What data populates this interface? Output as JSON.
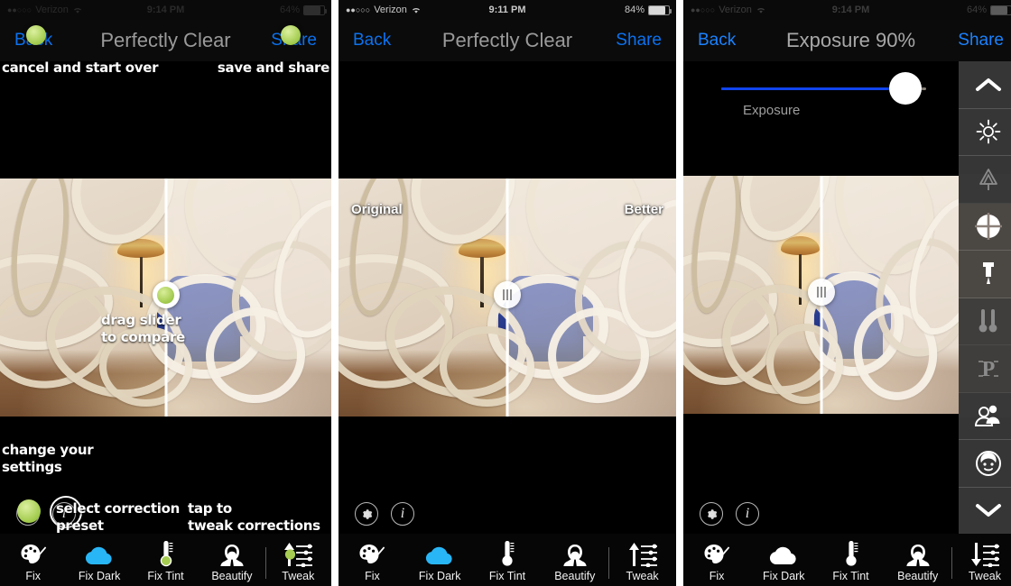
{
  "app": {
    "name": "Perfectly Clear"
  },
  "colors": {
    "link_blue": "#0b72f0",
    "slider_blue": "#1144ee",
    "cloud_blue": "#29b6f6",
    "accent_green": "#9fc84a",
    "sidebar_gray": "#3a3a3a",
    "title_gray": "#9a9a9a"
  },
  "panels": [
    {
      "id": "panel-annotated-overview",
      "status": {
        "carrier": "Verizon",
        "signal_dots": "●●○○○",
        "wifi_icon": "wifi-icon",
        "time": "9:14 PM",
        "battery_percent": "64%",
        "battery_icon": "battery-icon"
      },
      "nav": {
        "back": "Back",
        "title": "Perfectly Clear",
        "share": "Share"
      },
      "annotations": {
        "back_note": "cancel and start over",
        "share_note": "save and share",
        "compare_note": "drag slider\nto compare",
        "settings_note": "change your\nsettings",
        "preset_note": "select correction\npreset",
        "tweak_note": "tap to\ntweak corrections"
      },
      "tools": {
        "gear": "gear-icon",
        "info": "info-icon"
      },
      "tabs": [
        {
          "label": "Fix",
          "icon": "palette-icon",
          "active": false
        },
        {
          "label": "Fix Dark",
          "icon": "cloud-icon",
          "active": true
        },
        {
          "label": "Fix Tint",
          "icon": "thermometer-icon",
          "active": false
        },
        {
          "label": "Beautify",
          "icon": "face-icon",
          "active": false
        },
        {
          "label": "Tweak",
          "icon": "sliders-up-icon",
          "active": false
        }
      ]
    },
    {
      "id": "panel-compare",
      "status": {
        "carrier": "Verizon",
        "signal_dots": "●●○○○",
        "wifi_icon": "wifi-icon",
        "time": "9:11 PM",
        "battery_percent": "84%",
        "battery_icon": "battery-icon"
      },
      "nav": {
        "back": "Back",
        "title": "Perfectly Clear",
        "share": "Share"
      },
      "photo_labels": {
        "left": "Original",
        "right": "Better"
      },
      "tools": {
        "gear": "gear-icon",
        "info": "info-icon"
      },
      "tabs": [
        {
          "label": "Fix",
          "icon": "palette-icon",
          "active": false
        },
        {
          "label": "Fix Dark",
          "icon": "cloud-icon",
          "active": true
        },
        {
          "label": "Fix Tint",
          "icon": "thermometer-icon",
          "active": false
        },
        {
          "label": "Beautify",
          "icon": "face-icon",
          "active": false
        },
        {
          "label": "Tweak",
          "icon": "sliders-up-icon",
          "active": false
        }
      ]
    },
    {
      "id": "panel-exposure",
      "status": {
        "carrier": "Verizon",
        "signal_dots": "●●○○○",
        "wifi_icon": "wifi-icon",
        "time": "9:14 PM",
        "battery_percent": "64%",
        "battery_icon": "battery-icon"
      },
      "nav": {
        "back": "Back",
        "title": "Exposure 90%",
        "share": "Share"
      },
      "slider": {
        "label": "Exposure",
        "value": 90,
        "min": 0,
        "max": 100
      },
      "sidebar": [
        {
          "icon": "chevron-up-icon",
          "name": "scroll-up"
        },
        {
          "icon": "sun-icon",
          "name": "exposure"
        },
        {
          "icon": "tree-icon",
          "name": "depth"
        },
        {
          "icon": "contrast-circle-icon",
          "name": "contrast"
        },
        {
          "icon": "pin-sharpen-icon",
          "name": "sharpen"
        },
        {
          "icon": "thermometers-icon",
          "name": "tint"
        },
        {
          "icon": "p-letter-icon",
          "name": "presets"
        },
        {
          "icon": "people-icon",
          "name": "group"
        },
        {
          "icon": "face-beautify-icon",
          "name": "beautify"
        },
        {
          "icon": "chevron-down-icon",
          "name": "scroll-down"
        }
      ],
      "tools": {
        "gear": "gear-icon",
        "info": "info-icon"
      },
      "tabs": [
        {
          "label": "Fix",
          "icon": "palette-icon",
          "active": false
        },
        {
          "label": "Fix Dark",
          "icon": "cloud-icon",
          "active": false
        },
        {
          "label": "Fix Tint",
          "icon": "thermometer-icon",
          "active": false
        },
        {
          "label": "Beautify",
          "icon": "face-icon",
          "active": false
        },
        {
          "label": "Tweak",
          "icon": "sliders-down-icon",
          "active": true
        }
      ]
    }
  ]
}
